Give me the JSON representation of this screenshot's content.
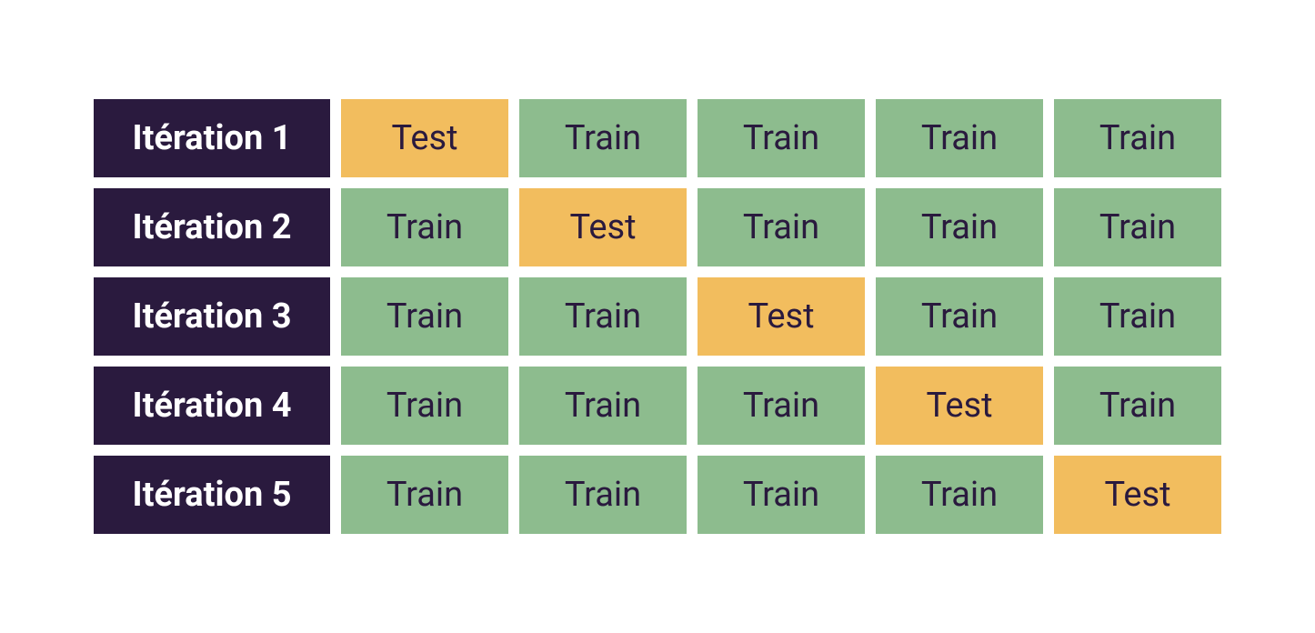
{
  "colors": {
    "header_bg": "#2a1a3e",
    "header_fg": "#ffffff",
    "train_bg": "#8dbc8e",
    "test_bg": "#f2bd5e",
    "cell_fg": "#2a1a3e"
  },
  "labels": {
    "train": "Train",
    "test": "Test"
  },
  "rows": [
    {
      "label": "Itération 1",
      "folds": [
        "test",
        "train",
        "train",
        "train",
        "train"
      ]
    },
    {
      "label": "Itération 2",
      "folds": [
        "train",
        "test",
        "train",
        "train",
        "train"
      ]
    },
    {
      "label": "Itération 3",
      "folds": [
        "train",
        "train",
        "test",
        "train",
        "train"
      ]
    },
    {
      "label": "Itération 4",
      "folds": [
        "train",
        "train",
        "train",
        "test",
        "train"
      ]
    },
    {
      "label": "Itération 5",
      "folds": [
        "train",
        "train",
        "train",
        "train",
        "test"
      ]
    }
  ]
}
